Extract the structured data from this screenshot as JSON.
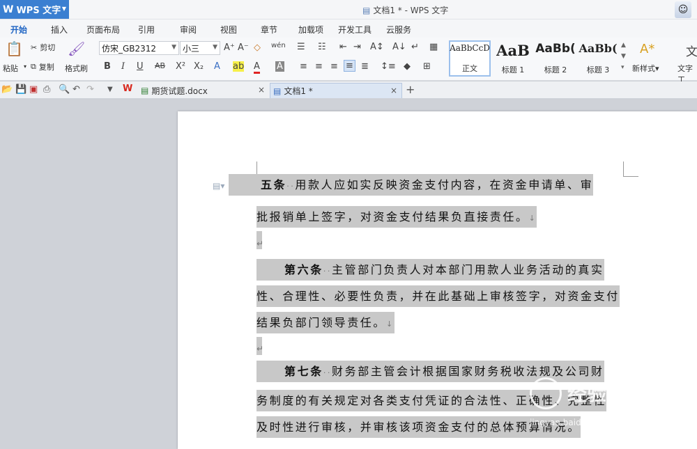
{
  "app": {
    "name": "WPS 文字",
    "window_title": "文档1 * - WPS 文字"
  },
  "menu_tabs": [
    "开始",
    "插入",
    "页面布局",
    "引用",
    "审阅",
    "视图",
    "章节",
    "加载项",
    "开发工具",
    "云服务"
  ],
  "ribbon": {
    "paste": "粘贴",
    "cut": "剪切",
    "copy": "复制",
    "format_painter": "格式刷",
    "font_name": "仿宋_GB2312",
    "font_size": "小三",
    "styles": [
      {
        "sample": "AaBbCcD",
        "label": "正文"
      },
      {
        "sample": "AaB",
        "label": "标题 1"
      },
      {
        "sample": "AaBb(",
        "label": "标题 2"
      },
      {
        "sample": "AaBb(",
        "label": "标题 3"
      }
    ],
    "new_style": "新样式",
    "text_tools": "文字工"
  },
  "doc_tabs": [
    {
      "name": "期货试题.docx",
      "active": false
    },
    {
      "name": "文档1 *",
      "active": true
    }
  ],
  "document": {
    "p5": {
      "heading": "五条",
      "line1": "用款人应如实反映资金支付内容，在资金申请单、审",
      "line2": "批报销单上签字，对资金支付结果负直接责任。"
    },
    "p6": {
      "heading": "第六条",
      "line1": "主管部门负责人对本部门用款人业务活动的真实",
      "line2": "性、合理性、必要性负责，并在此基础上审核签字，对资金支付",
      "line3": "结果负部门领导责任。"
    },
    "p7": {
      "heading": "第七条",
      "line1": "财务部主管会计根据国家财务税收法规及公司财",
      "line2": "务制度的有关规定对各类支付凭证的合法性、正确性、完整性",
      "line3": "及时性进行审核，并审核该项资金支付的总体预算情况。"
    }
  },
  "watermark": {
    "text": "经验",
    "site": "jingyan.baidu.com"
  }
}
